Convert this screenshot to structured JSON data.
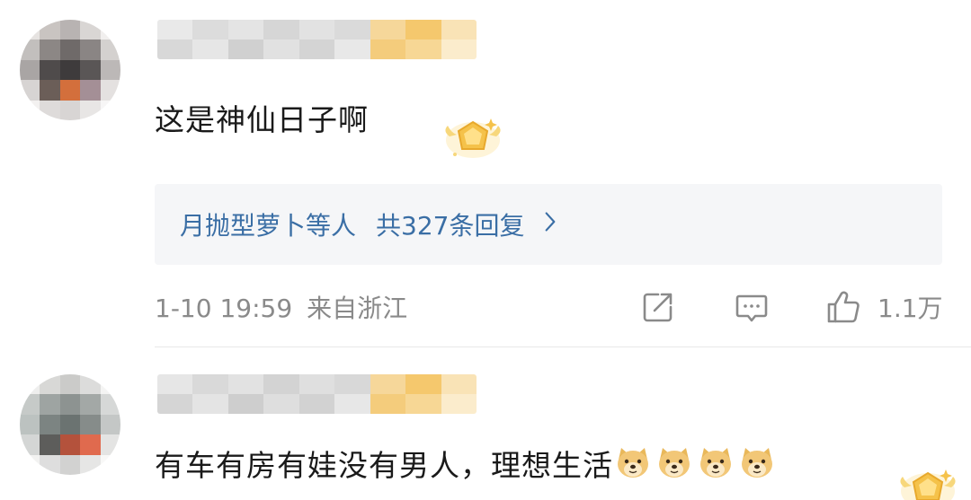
{
  "comments": [
    {
      "text": "这是神仙日子啊",
      "reply_preview": {
        "names": "月抛型萝卜等人",
        "count_text": "共327条回复"
      },
      "meta": {
        "time": "1-10 19:59",
        "location": "来自浙江"
      },
      "actions": {
        "like_count": "1.1万"
      }
    },
    {
      "text": "有车有房有娃没有男人，理想生活",
      "emojis": [
        "doge-icon",
        "doge-icon",
        "doge-icon",
        "doge-icon"
      ]
    }
  ],
  "colors": {
    "link": "#3a6ea5",
    "muted": "#8a8a8a",
    "reply_bg": "#f5f6f8",
    "badge_gold": "#f5c24a"
  }
}
